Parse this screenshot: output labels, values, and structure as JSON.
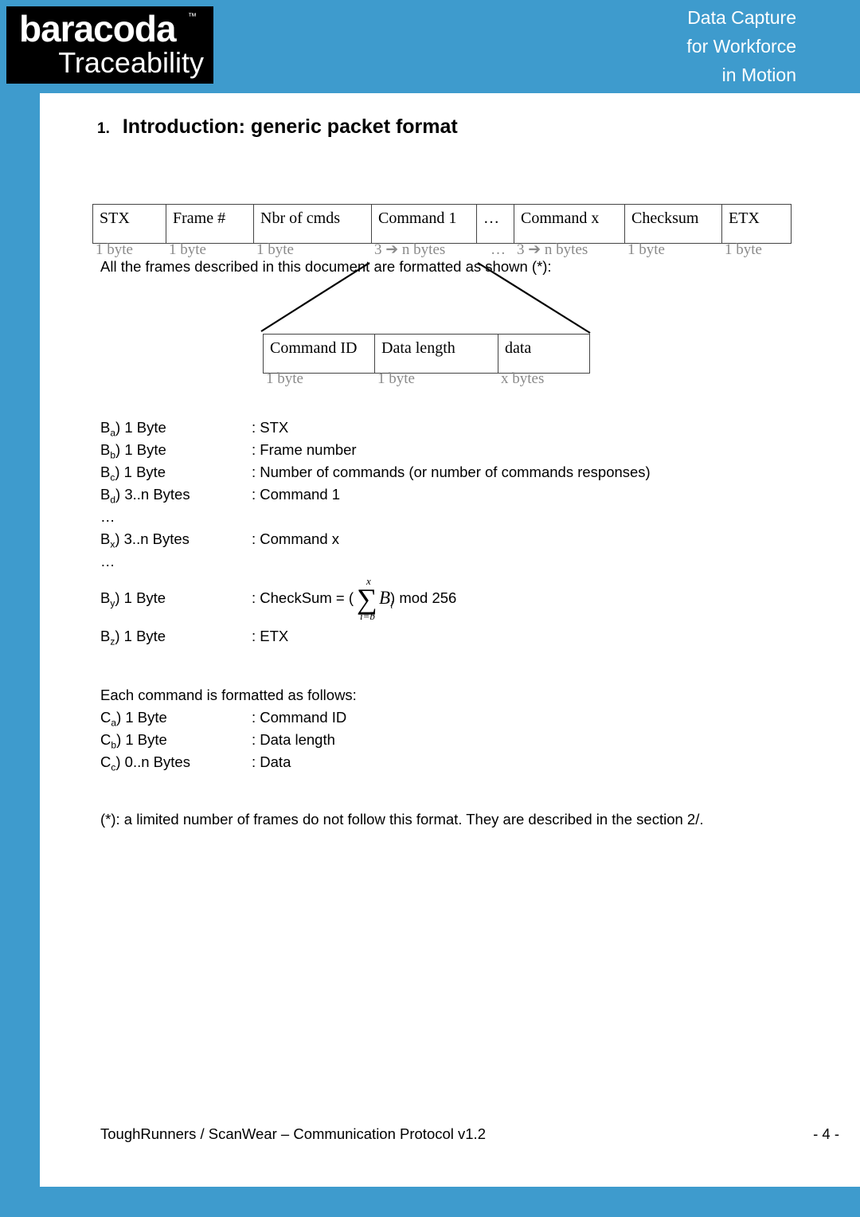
{
  "header": {
    "logo": {
      "brand": "baracoda",
      "trademark": "™",
      "subtitle": "Traceability"
    },
    "tagline": [
      "Data Capture",
      "for Workforce",
      "in Motion"
    ],
    "band_color": "#3e9bcd"
  },
  "section": {
    "number": "1.",
    "title": "Introduction: generic packet format"
  },
  "intro_line": "All the frames described in this document are formatted as shown (*):",
  "frame_table": {
    "cells": [
      "STX",
      "Frame #",
      "Nbr of cmds",
      "Command 1",
      "…",
      "Command x",
      "Checksum",
      "ETX"
    ],
    "sizes": [
      "1 byte",
      "1 byte",
      "1 byte",
      "3 ➔ n bytes",
      "…",
      "3 ➔ n bytes",
      "1 byte",
      "1 byte"
    ]
  },
  "command_table": {
    "cells": [
      "Command ID",
      "Data length",
      "data"
    ],
    "sizes": [
      "1 byte",
      "1 byte",
      "x bytes"
    ]
  },
  "byte_definitions": [
    {
      "label_prefix": "B",
      "label_sub": "a",
      "label_suffix": ") 1 Byte",
      "value": ": STX"
    },
    {
      "label_prefix": "B",
      "label_sub": "b",
      "label_suffix": ") 1 Byte",
      "value": ": Frame number"
    },
    {
      "label_prefix": "B",
      "label_sub": "c",
      "label_suffix": ") 1 Byte",
      "value": ": Number of commands (or number of commands responses)"
    },
    {
      "label_prefix": "B",
      "label_sub": "d",
      "label_suffix": ") 3..n Bytes",
      "value": ": Command 1"
    },
    {
      "label_prefix": "…",
      "label_sub": "",
      "label_suffix": "",
      "value": ""
    },
    {
      "label_prefix": "B",
      "label_sub": "x",
      "label_suffix": ") 3..n Bytes",
      "value": ": Command x"
    },
    {
      "label_prefix": "…",
      "label_sub": "",
      "label_suffix": "",
      "value": ""
    }
  ],
  "checksum_row": {
    "label_prefix": "B",
    "label_sub": "y",
    "label_suffix": ") 1 Byte",
    "value_before": ": CheckSum = (",
    "sigma": "∑",
    "sum_upper": "x",
    "sum_lower": "i=b",
    "sum_term": "B",
    "sum_term_sub": "i",
    "value_after": ") mod 256"
  },
  "etx_row": {
    "label_prefix": "B",
    "label_sub": "z",
    "label_suffix": ") 1 Byte",
    "value": ": ETX"
  },
  "command_intro": "Each command is formatted as follows:",
  "command_definitions": [
    {
      "label_prefix": "C",
      "label_sub": "a",
      "label_suffix": ") 1 Byte",
      "value": ": Command ID"
    },
    {
      "label_prefix": "C",
      "label_sub": "b",
      "label_suffix": ") 1 Byte",
      "value": ": Data length"
    },
    {
      "label_prefix": "C",
      "label_sub": "c",
      "label_suffix": ") 0..n Bytes",
      "value": ": Data"
    }
  ],
  "footnote": "(*): a limited number of frames do not follow this format. They are described in the section 2/.",
  "footer": {
    "left": "ToughRunners / ScanWear – Communication Protocol v1.2",
    "right": "- 4 -"
  }
}
